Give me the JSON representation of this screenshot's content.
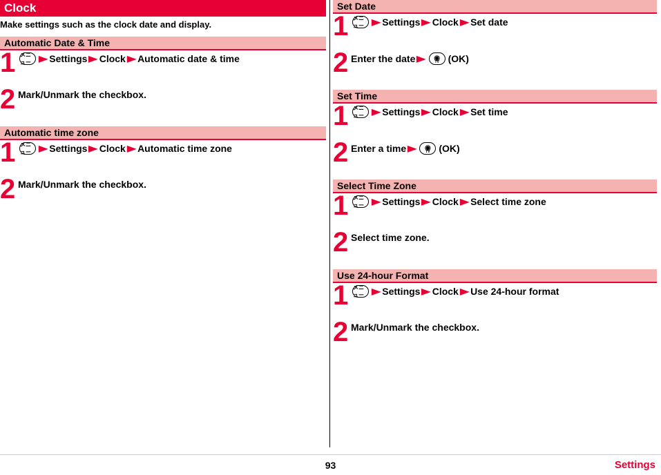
{
  "page_title": "Clock",
  "intro": "Make settings such as the clock date and display.",
  "menu_icon_label": "メニュー",
  "tv_ok_label": "TV",
  "arrow": "▶",
  "left_sections": [
    {
      "heading": "Automatic Date & Time",
      "steps": [
        {
          "num": "1",
          "has_menu_icon": true,
          "segments": [
            "Settings",
            "Clock",
            "Automatic date & time"
          ]
        },
        {
          "num": "2",
          "plain": "Mark/Unmark the checkbox."
        }
      ]
    },
    {
      "heading": "Automatic time zone",
      "steps": [
        {
          "num": "1",
          "has_menu_icon": true,
          "segments": [
            "Settings",
            "Clock",
            "Automatic time zone"
          ]
        },
        {
          "num": "2",
          "plain": "Mark/Unmark the checkbox."
        }
      ]
    }
  ],
  "right_sections": [
    {
      "heading": "Set Date",
      "steps": [
        {
          "num": "1",
          "has_menu_icon": true,
          "segments": [
            "Settings",
            "Clock",
            "Set date"
          ]
        },
        {
          "num": "2",
          "prefix": "Enter the date",
          "has_tv_icon": true,
          "suffix": "(OK)"
        }
      ]
    },
    {
      "heading": "Set Time",
      "steps": [
        {
          "num": "1",
          "has_menu_icon": true,
          "segments": [
            "Settings",
            "Clock",
            "Set time"
          ]
        },
        {
          "num": "2",
          "prefix": "Enter a time",
          "has_tv_icon": true,
          "suffix": "(OK)"
        }
      ]
    },
    {
      "heading": "Select Time Zone",
      "steps": [
        {
          "num": "1",
          "has_menu_icon": true,
          "segments": [
            "Settings",
            "Clock",
            "Select time zone"
          ]
        },
        {
          "num": "2",
          "plain": "Select time zone."
        }
      ]
    },
    {
      "heading": "Use 24-hour Format",
      "steps": [
        {
          "num": "1",
          "has_menu_icon": true,
          "segments": [
            "Settings",
            "Clock",
            "Use 24-hour format"
          ]
        },
        {
          "num": "2",
          "plain": "Mark/Unmark the checkbox."
        }
      ]
    }
  ],
  "footer": {
    "page": "93",
    "section": "Settings"
  }
}
